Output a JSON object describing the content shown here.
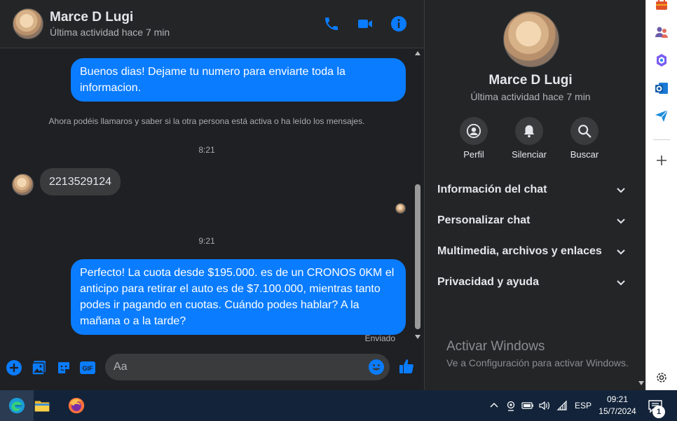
{
  "contact": {
    "name": "Marce D Lugi",
    "last_active": "Última actividad hace 7 min"
  },
  "header_actions": [
    "phone-icon",
    "video-call-icon",
    "info-icon"
  ],
  "messages": {
    "out_1": "Buenos dias! Dejame tu numero para enviarte toda la informacion.",
    "system_notice": "Ahora podéis llamaros y saber si la otra persona está activa o ha leído los mensajes.",
    "time_1": "8:21",
    "in_1": "2213529124",
    "time_2": "9:21",
    "out_2": "Perfecto! La cuota desde $195.000. es de un CRONOS 0KM el anticipo para retirar el auto es de $7.100.000, mientras tanto podes ir pagando en cuotas. Cuándo podes hablar? A la mañana o a la tarde?",
    "status": "Enviado"
  },
  "composer": {
    "placeholder": "Aa",
    "icons": [
      "plus-circle-icon",
      "image-icon",
      "sticker-icon",
      "gif-icon",
      "emoji-icon",
      "thumbs-up-icon"
    ]
  },
  "panel": {
    "name": "Marce D Lugi",
    "last_active": "Última actividad hace 7 min",
    "actions": [
      {
        "label": "Perfil",
        "icon": "profile-icon"
      },
      {
        "label": "Silenciar",
        "icon": "bell-icon"
      },
      {
        "label": "Buscar",
        "icon": "search-icon"
      }
    ],
    "sections": [
      "Información del chat",
      "Personalizar chat",
      "Multimedia, archivos y enlaces",
      "Privacidad y ayuda"
    ],
    "watermark_title": "Activar Windows",
    "watermark_sub": "Ve a Configuración para activar Windows."
  },
  "colors": {
    "accent": "#0a7cff",
    "background": "#1f2023",
    "panel": "#242526",
    "bubble_in": "#3a3b3c",
    "taskbar": "#13243a"
  },
  "taskbar": {
    "apps": [
      "edge-icon",
      "file-explorer-icon",
      "firefox-icon"
    ],
    "language": "ESP",
    "time": "09:21",
    "date": "15/7/2024",
    "notifications": "1"
  }
}
